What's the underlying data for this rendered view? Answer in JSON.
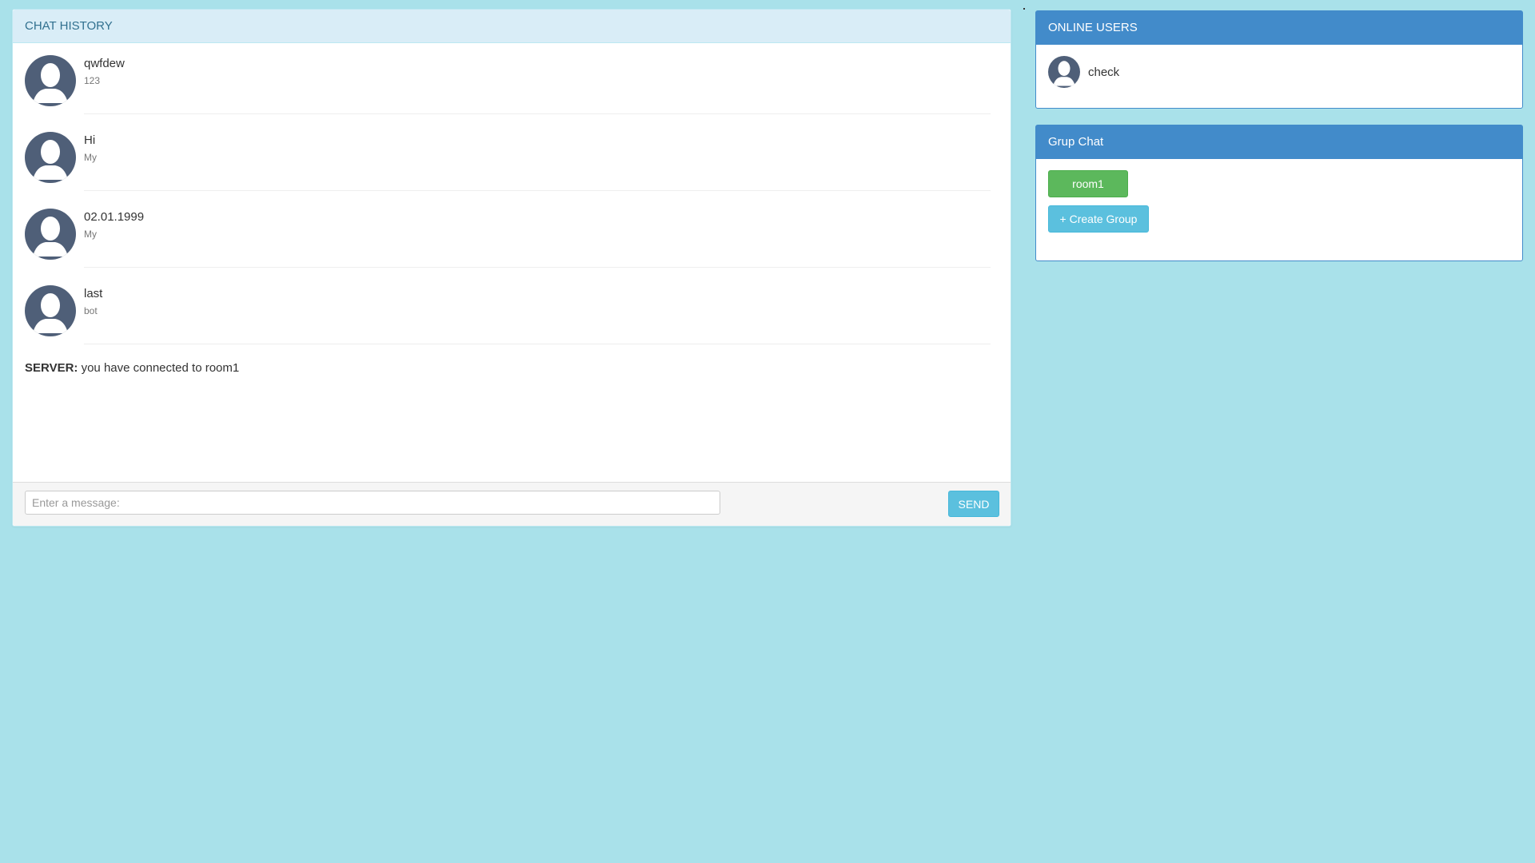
{
  "chat": {
    "heading": "CHAT HISTORY",
    "messages": [
      {
        "text": "qwfdew",
        "sub": "123"
      },
      {
        "text": "Hi",
        "sub": "My"
      },
      {
        "text": "02.01.1999",
        "sub": "My"
      },
      {
        "text": "last",
        "sub": "bot"
      }
    ],
    "server_label": "SERVER:",
    "server_message": "you have connected to room1",
    "input_placeholder": "Enter a message:",
    "send_label": "SEND"
  },
  "online_users": {
    "heading": "ONLINE USERS",
    "users": [
      {
        "name": "check"
      }
    ]
  },
  "group_chat": {
    "heading": "Grup Chat",
    "rooms": [
      {
        "label": "room1"
      }
    ],
    "create_label": "+ Create Group"
  },
  "icons": {
    "avatar": "user-avatar-icon"
  },
  "colors": {
    "background": "#a9e1ea",
    "primary": "#428bca",
    "info": "#5bc0de",
    "success": "#5cb85c",
    "avatar": "#4f5f78"
  }
}
